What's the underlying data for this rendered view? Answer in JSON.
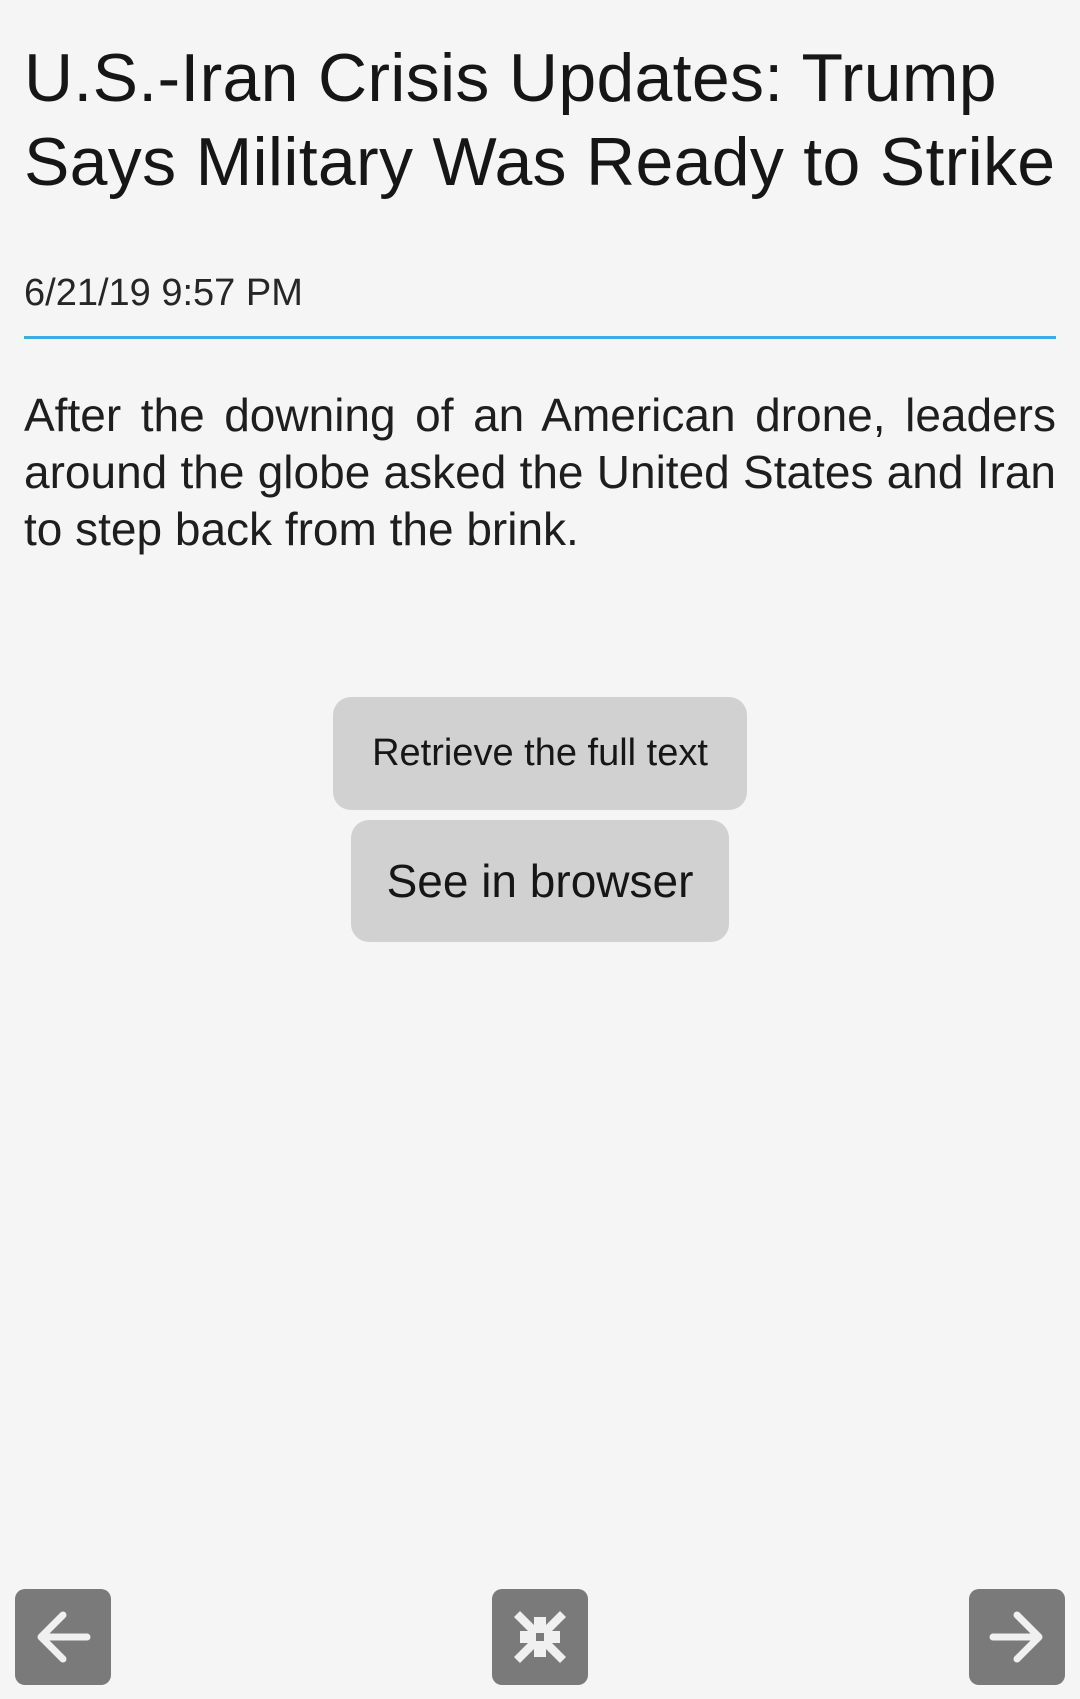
{
  "article": {
    "title": "U.S.-Iran Crisis Updates: Trump Says Military Was Ready to Strike",
    "date": "6/21/19 9:57 PM",
    "summary": "After the downing of an American drone, leaders around the globe asked the United States and Iran to step back from the brink."
  },
  "actions": {
    "retrieve_label": "Retrieve the full text",
    "browser_label": "See in browser"
  },
  "navigation": {
    "prev_icon": "arrow-left-icon",
    "shrink_icon": "collapse-arrows-icon",
    "next_icon": "arrow-right-icon"
  },
  "colors": {
    "background": "#f5f5f5",
    "accent_rule": "#3aaee0",
    "button_bg": "#d1d1d1",
    "nav_button_bg": "#7a7a7a"
  }
}
